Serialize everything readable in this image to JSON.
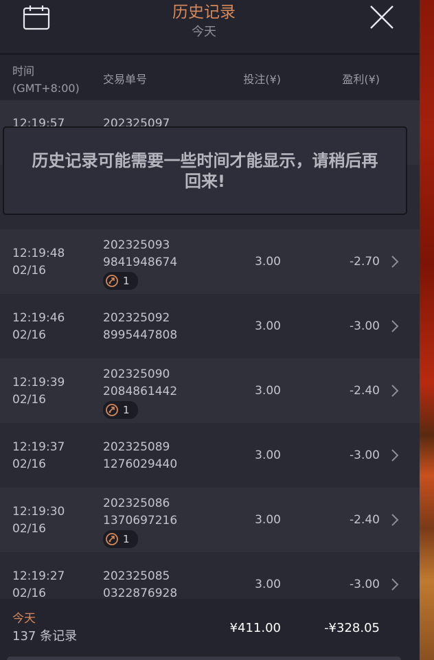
{
  "header": {
    "title": "历史记录",
    "subtitle": "今天",
    "calendar_icon": "calendar-icon",
    "close_icon": "close-icon"
  },
  "columns": {
    "time_line1": "时间",
    "time_line2": "(GMT+8:00)",
    "trade_id": "交易单号",
    "bet": "投注(¥)",
    "profit": "盈利(¥)"
  },
  "notice": "历史记录可能需要一些时间才能显示，请稍后再回来!",
  "rows": [
    {
      "time": "12:19:57",
      "date": "",
      "id1": "202325097",
      "id2": "",
      "badge": "",
      "bet": "",
      "profit": ""
    },
    {
      "time": "",
      "date": "",
      "id1": "",
      "id2": "",
      "badge": "",
      "bet": "",
      "profit": ""
    },
    {
      "time": "12:19:48",
      "date": "02/16",
      "id1": "202325093",
      "id2": "9841948674",
      "badge": "1",
      "bet": "3.00",
      "profit": "-2.70"
    },
    {
      "time": "12:19:46",
      "date": "02/16",
      "id1": "202325092",
      "id2": "8995447808",
      "badge": "",
      "bet": "3.00",
      "profit": "-3.00"
    },
    {
      "time": "12:19:39",
      "date": "02/16",
      "id1": "202325090",
      "id2": "2084861442",
      "badge": "1",
      "bet": "3.00",
      "profit": "-2.40"
    },
    {
      "time": "12:19:37",
      "date": "02/16",
      "id1": "202325089",
      "id2": "1276029440",
      "badge": "",
      "bet": "3.00",
      "profit": "-3.00"
    },
    {
      "time": "12:19:30",
      "date": "02/16",
      "id1": "202325086",
      "id2": "1370697216",
      "badge": "1",
      "bet": "3.00",
      "profit": "-2.40"
    },
    {
      "time": "12:19:27",
      "date": "02/16",
      "id1": "202325085",
      "id2": "0322876928",
      "badge": "",
      "bet": "3.00",
      "profit": "-3.00"
    }
  ],
  "footer": {
    "label": "今天",
    "count": "137 条记录",
    "total_bet": "¥411.00",
    "total_profit": "-¥328.05"
  },
  "colors": {
    "accent": "#d7895a",
    "panel": "#24242f",
    "row_alt": "#30303b",
    "row": "#2a2a35"
  }
}
